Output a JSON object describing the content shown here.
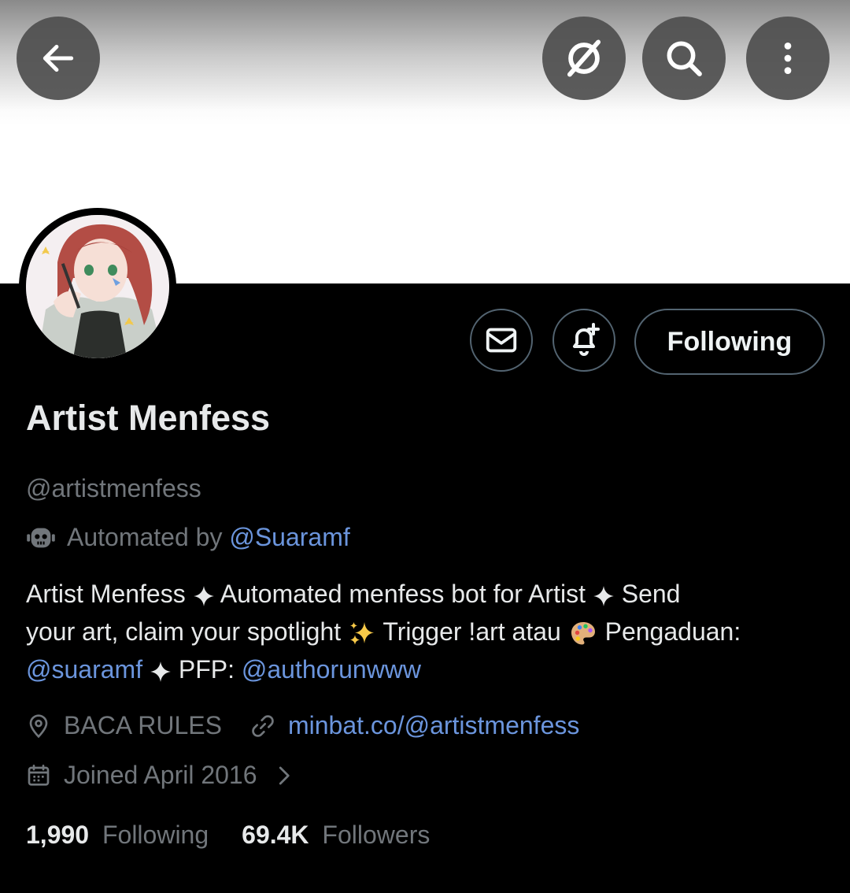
{
  "header": {
    "back_icon": "arrow-left-icon",
    "grok_icon": "slashed-circle-icon",
    "search_icon": "search-icon",
    "more_icon": "more-vertical-icon"
  },
  "actions": {
    "message_icon": "envelope-icon",
    "notify_icon": "bell-plus-icon",
    "follow_label": "Following"
  },
  "profile": {
    "display_name": "Artist Menfess",
    "handle": "@artistmenfess",
    "automated_prefix": "Automated by",
    "automated_by": "@Suaramf",
    "bio": {
      "l1_a": "Artist Menfess",
      "l1_b": "Automated menfess bot for Artist",
      "l1_c": "Send",
      "l2_a": "your art, claim your spotlight",
      "l2_b": "Trigger !art atau",
      "l2_c": "Pengaduan:",
      "l3_mention1": "@suaramf",
      "l3_b": "PFP:",
      "l3_mention2": "@authorunwww"
    },
    "location": "BACA RULES",
    "website": "minbat.co/@artistmenfess",
    "joined": "Joined April 2016"
  },
  "stats": {
    "following_count": "1,990",
    "following_label": "Following",
    "followers_count": "69.4K",
    "followers_label": "Followers"
  },
  "colors": {
    "link": "#6b95dd",
    "muted": "#71767b",
    "text": "#e7e9ea",
    "border": "#536471"
  }
}
